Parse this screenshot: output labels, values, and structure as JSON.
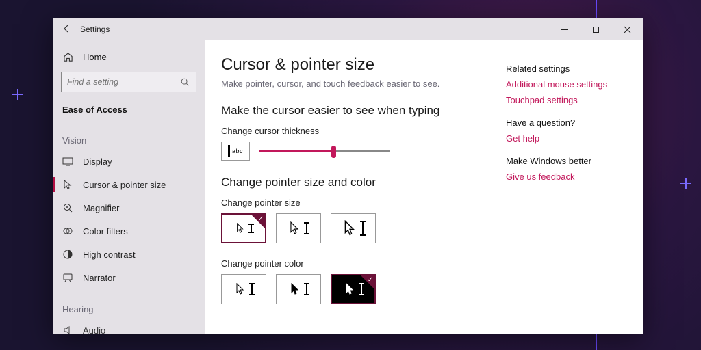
{
  "window": {
    "title": "Settings"
  },
  "sidebar": {
    "home": "Home",
    "search_placeholder": "Find a setting",
    "category": "Ease of Access",
    "group_vision": "Vision",
    "items_vision": [
      {
        "label": "Display"
      },
      {
        "label": "Cursor & pointer size"
      },
      {
        "label": "Magnifier"
      },
      {
        "label": "Color filters"
      },
      {
        "label": "High contrast"
      },
      {
        "label": "Narrator"
      }
    ],
    "group_hearing": "Hearing",
    "items_hearing": [
      {
        "label": "Audio"
      }
    ]
  },
  "main": {
    "title": "Cursor & pointer size",
    "subtitle": "Make pointer, cursor, and touch feedback easier to see.",
    "section_cursor": "Make the cursor easier to see when typing",
    "cursor_thickness_label": "Change cursor thickness",
    "preview_text": "abc",
    "slider": {
      "min": 1,
      "max": 20,
      "value": 11
    },
    "section_pointer": "Change pointer size and color",
    "pointer_size_label": "Change pointer size",
    "pointer_size_options": [
      "small",
      "medium",
      "large"
    ],
    "pointer_size_selected": 0,
    "pointer_color_label": "Change pointer color",
    "pointer_color_options": [
      "white",
      "black",
      "inverted"
    ],
    "pointer_color_selected": 2
  },
  "aside": {
    "related_title": "Related settings",
    "related_links": [
      "Additional mouse settings",
      "Touchpad settings"
    ],
    "question_title": "Have a question?",
    "question_link": "Get help",
    "feedback_title": "Make Windows better",
    "feedback_link": "Give us feedback"
  },
  "colors": {
    "accent": "#c2185b"
  }
}
